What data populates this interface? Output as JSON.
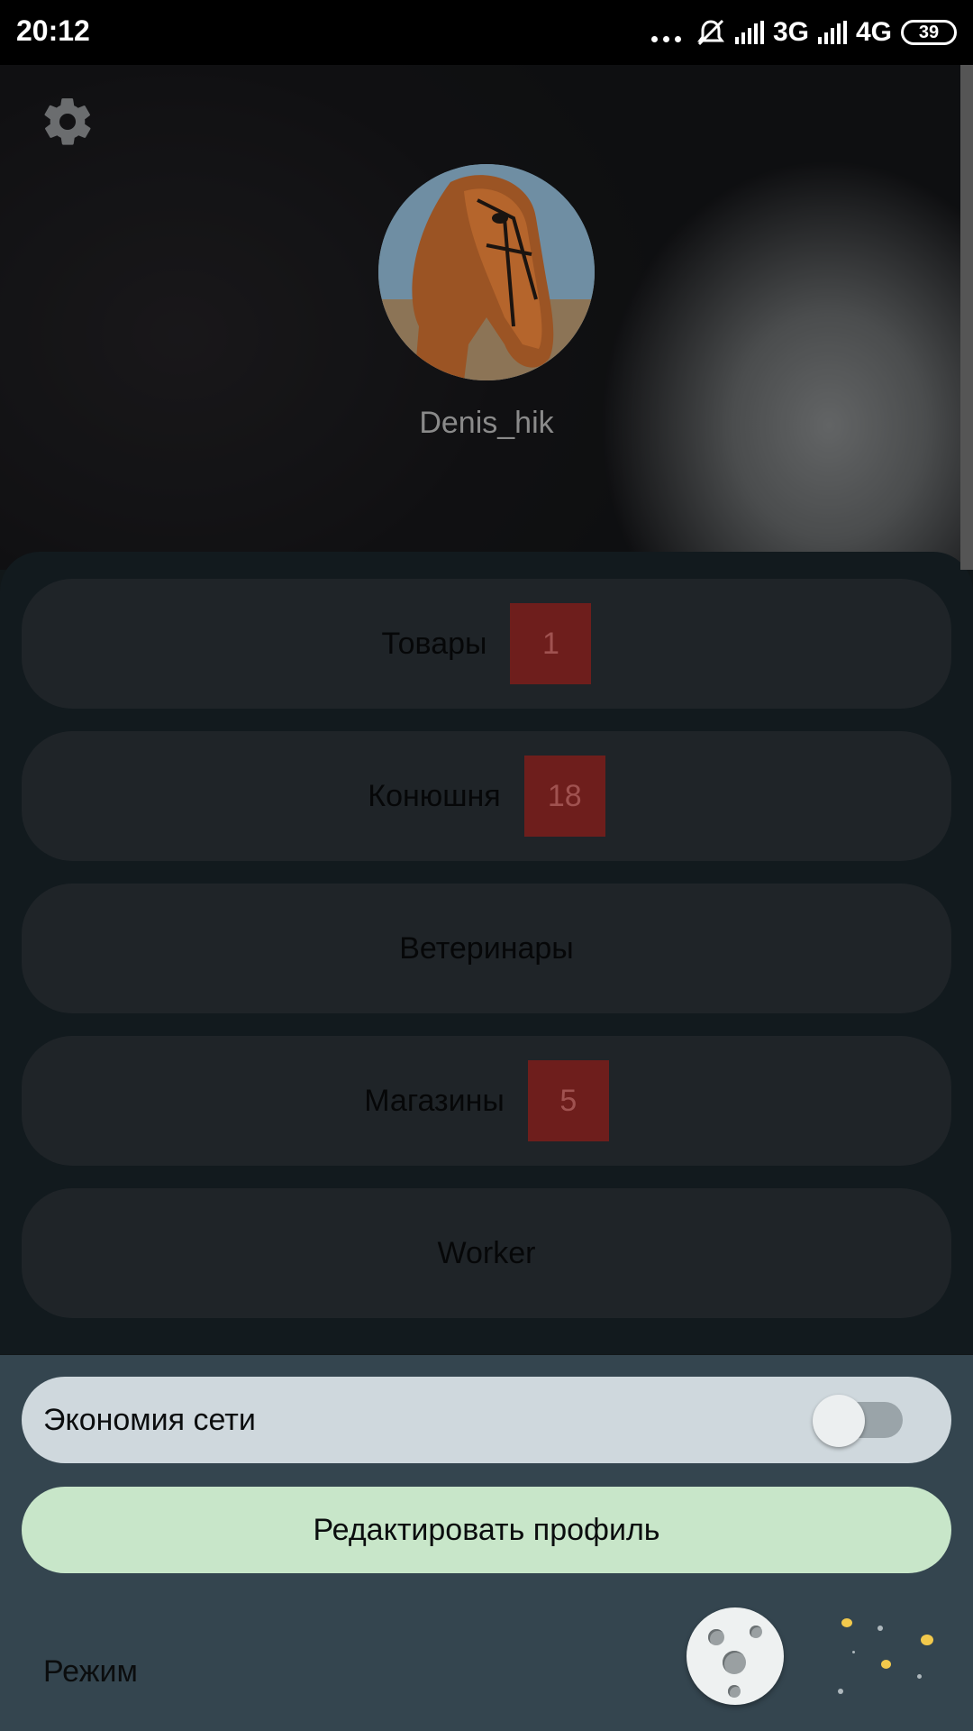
{
  "status_bar": {
    "time": "20:12",
    "network_1": "3G",
    "network_2": "4G",
    "battery": "39",
    "icons": [
      "more-dots-icon",
      "alarm-off-icon",
      "signal-icon",
      "signal-icon"
    ]
  },
  "header": {
    "settings_icon": "gear-icon",
    "username": "Denis_hik"
  },
  "menu": {
    "items": [
      {
        "label": "Товары",
        "badge": "1"
      },
      {
        "label": "Конюшня",
        "badge": "18"
      },
      {
        "label": "Ветеринары",
        "badge": null
      },
      {
        "label": "Магазины",
        "badge": "5"
      },
      {
        "label": "Worker",
        "badge": null
      }
    ]
  },
  "bottom": {
    "network_saving_label": "Экономия сети",
    "network_saving_enabled": false,
    "edit_profile_label": "Редактировать профиль",
    "mode_label": "Режим",
    "mode_icon": "moon-icon"
  },
  "colors": {
    "badge": "#6e1e1c",
    "edit_button": "#c8e6c9",
    "bottom_panel": "#34454f",
    "star": "#f2c94c"
  }
}
